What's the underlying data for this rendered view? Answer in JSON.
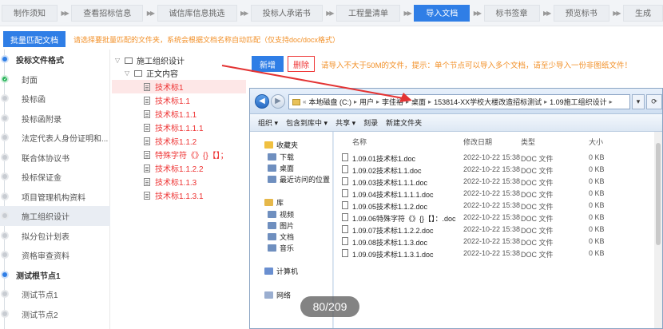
{
  "steps": [
    {
      "label": "制作须知",
      "active": false
    },
    {
      "label": "查看招标信息",
      "active": false
    },
    {
      "label": "诚信库信息挑选",
      "active": false
    },
    {
      "label": "投标人承诺书",
      "active": false
    },
    {
      "label": "工程量清单",
      "active": false
    },
    {
      "label": "导入文档",
      "active": true
    },
    {
      "label": "标书签章",
      "active": false
    },
    {
      "label": "预览标书",
      "active": false
    },
    {
      "label": "生成",
      "active": false
    }
  ],
  "toolbar": {
    "batch_button": "批量匹配文档",
    "batch_hint": "请选择要批量匹配的文件夹，系统会根据文档名称自动匹配（仅支持doc/docx格式）"
  },
  "left_tree": [
    {
      "label": "投标文件格式",
      "kind": "bold"
    },
    {
      "label": "封面",
      "kind": "check"
    },
    {
      "label": "投标函",
      "kind": "grey"
    },
    {
      "label": "投标函附录",
      "kind": "grey"
    },
    {
      "label": "法定代表人身份证明和...",
      "kind": "grey"
    },
    {
      "label": "联合体协议书",
      "kind": "grey"
    },
    {
      "label": "投标保证金",
      "kind": "grey"
    },
    {
      "label": "项目管理机构资料",
      "kind": "grey"
    },
    {
      "label": "施工组织设计",
      "kind": "grey",
      "selected": true
    },
    {
      "label": "拟分包计划表",
      "kind": "grey"
    },
    {
      "label": "资格审查资料",
      "kind": "grey"
    },
    {
      "label": "测试根节点1",
      "kind": "bold"
    },
    {
      "label": "测试节点1",
      "kind": "grey"
    },
    {
      "label": "测试节点2",
      "kind": "grey"
    }
  ],
  "mid_tree": {
    "root": "施工组织设计",
    "group": "正文内容",
    "items": [
      "技术标1",
      "技术标1.1",
      "技术标1.1.1",
      "技术标1.1.1.1",
      "技术标1.1.2",
      "特殊字符《》{}【】；",
      "技术标1.1.2.2",
      "技术标1.1.3",
      "技术标1.1.3.1"
    ]
  },
  "right": {
    "new_button": "新增",
    "delete_button": "删除",
    "hint": "请导入不大于50M的文件，提示：单个节点可以导入多个文档，请至少导入一份非图纸文件！"
  },
  "explorer": {
    "path": [
      "本地磁盘 (C:)",
      "用户",
      "李佳裕",
      "桌面",
      "153814-XX学校大楼改造招标测试",
      "1.09施工组织设计"
    ],
    "commands": [
      "组织 ▾",
      "包含到库中 ▾",
      "共享 ▾",
      "刻录",
      "新建文件夹"
    ],
    "nav_groups": [
      {
        "label": "收藏夹",
        "items": [
          "下载",
          "桌面",
          "最近访问的位置"
        ]
      },
      {
        "label": "库",
        "items": [
          "视频",
          "图片",
          "文档",
          "音乐"
        ]
      },
      {
        "label": "计算机",
        "items": []
      },
      {
        "label": "网络",
        "items": []
      }
    ],
    "columns": [
      "名称",
      "修改日期",
      "类型",
      "大小"
    ],
    "files": [
      {
        "name": "1.09.01技术标1.doc",
        "date": "2022-10-22 15:38",
        "type": "DOC 文件",
        "size": "0 KB"
      },
      {
        "name": "1.09.02技术标1.1.doc",
        "date": "2022-10-22 15:38",
        "type": "DOC 文件",
        "size": "0 KB"
      },
      {
        "name": "1.09.03技术标1.1.1.doc",
        "date": "2022-10-22 15:38",
        "type": "DOC 文件",
        "size": "0 KB"
      },
      {
        "name": "1.09.04技术标1.1.1.1.doc",
        "date": "2022-10-22 15:38",
        "type": "DOC 文件",
        "size": "0 KB"
      },
      {
        "name": "1.09.05技术标1.1.2.doc",
        "date": "2022-10-22 15:38",
        "type": "DOC 文件",
        "size": "0 KB"
      },
      {
        "name": "1.09.06特殊字符《》{}【】：.doc",
        "date": "2022-10-22 15:38",
        "type": "DOC 文件",
        "size": "0 KB"
      },
      {
        "name": "1.09.07技术标1.1.2.2.doc",
        "date": "2022-10-22 15:38",
        "type": "DOC 文件",
        "size": "0 KB"
      },
      {
        "name": "1.09.08技术标1.1.3.doc",
        "date": "2022-10-22 15:38",
        "type": "DOC 文件",
        "size": "0 KB"
      },
      {
        "name": "1.09.09技术标1.1.3.1.doc",
        "date": "2022-10-22 15:38",
        "type": "DOC 文件",
        "size": "0 KB"
      }
    ]
  },
  "pager": "80/209",
  "colors": {
    "primary": "#2f7ee6",
    "warning": "#f29028",
    "danger": "#e33333",
    "success": "#27b35a"
  }
}
